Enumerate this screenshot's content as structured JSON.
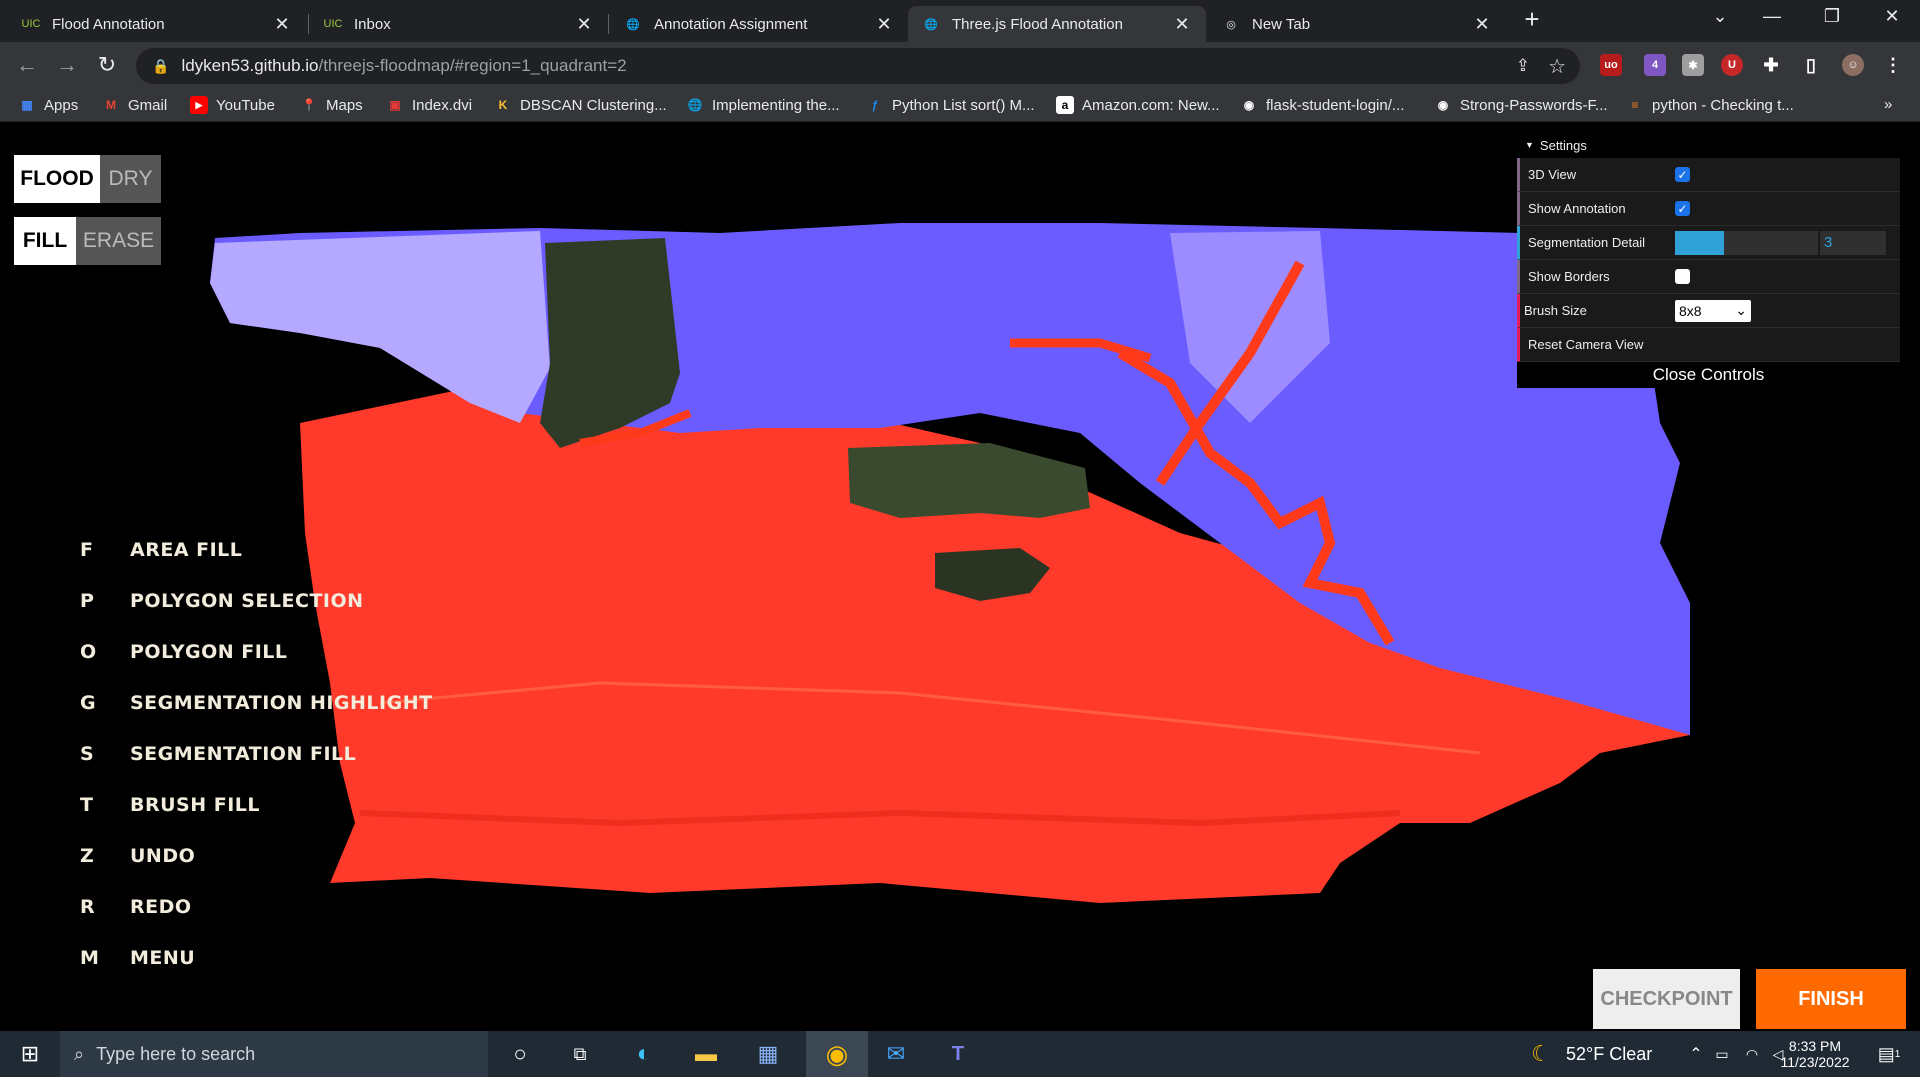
{
  "browser": {
    "tabs": [
      {
        "title": "Flood Annotation",
        "active": false
      },
      {
        "title": "Inbox",
        "active": false
      },
      {
        "title": "Annotation Assignment",
        "active": false
      },
      {
        "title": "Three.js Flood Annotation",
        "active": true
      },
      {
        "title": "New Tab",
        "active": false
      }
    ],
    "new_tab_label": "+",
    "url_host": "ldyken53.github.io",
    "url_path": "/threejs-floodmap/#region=1_quadrant=2",
    "extension_badge": "4",
    "bookmarks": [
      "Apps",
      "Gmail",
      "YouTube",
      "Maps",
      "Index.dvi",
      "DBSCAN Clustering...",
      "Implementing the...",
      "Python List sort() M...",
      "Amazon.com: New...",
      "flask-student-login/...",
      "Strong-Passwords-F...",
      "python - Checking t..."
    ],
    "bookmarks_overflow": "»"
  },
  "app": {
    "mode_toggle": {
      "active": "FLOOD",
      "inactive": "DRY"
    },
    "tool_toggle": {
      "active": "FILL",
      "inactive": "ERASE"
    },
    "shortcuts": [
      {
        "key": "F",
        "label": "AREA FILL"
      },
      {
        "key": "P",
        "label": "POLYGON SELECTION"
      },
      {
        "key": "O",
        "label": "POLYGON FILL"
      },
      {
        "key": "G",
        "label": "SEGMENTATION HIGHLIGHT"
      },
      {
        "key": "S",
        "label": "SEGMENTATION FILL"
      },
      {
        "key": "T",
        "label": "BRUSH FILL"
      },
      {
        "key": "Z",
        "label": "UNDO"
      },
      {
        "key": "R",
        "label": "REDO"
      },
      {
        "key": "M",
        "label": "MENU"
      }
    ],
    "settings": {
      "title": "Settings",
      "view_3d_label": "3D View",
      "view_3d": true,
      "show_annotation_label": "Show Annotation",
      "show_annotation": true,
      "segmentation_detail_label": "Segmentation Detail",
      "segmentation_detail_value": "3",
      "segmentation_detail_fraction": 0.34,
      "show_borders_label": "Show Borders",
      "show_borders": false,
      "brush_size_label": "Brush Size",
      "brush_size_value": "8x8",
      "reset_camera_label": "Reset Camera View",
      "close_label": "Close Controls"
    },
    "checkpoint_label": "CHECKPOINT",
    "finish_label": "FINISH",
    "colors": {
      "flood": "#ff3a2a",
      "dry": "#6a5cff",
      "finish": "#ff6a00"
    }
  },
  "taskbar": {
    "search_placeholder": "Type here to search",
    "weather": "52°F  Clear",
    "time": "8:33 PM",
    "date": "11/23/2022",
    "notification_count": "1"
  }
}
